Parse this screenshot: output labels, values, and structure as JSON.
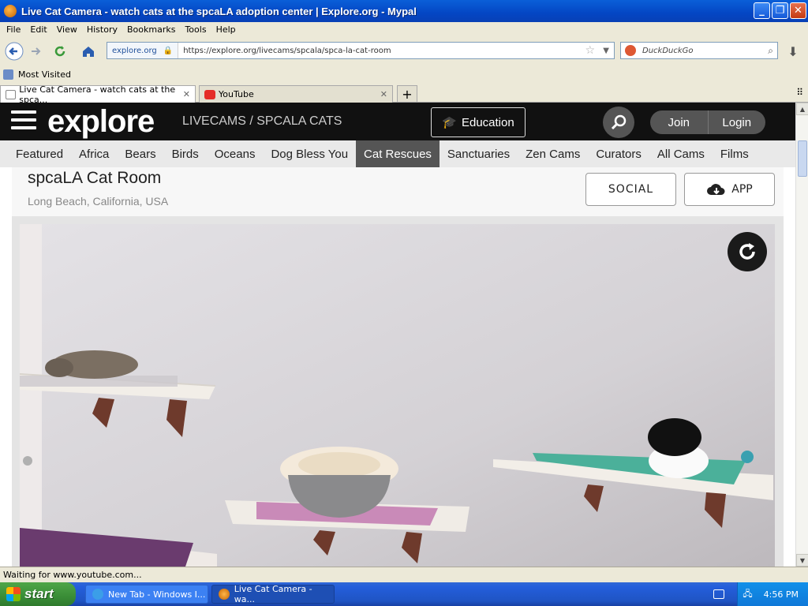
{
  "window": {
    "title": "Live Cat Camera - watch cats at the spcaLA adoption center | Explore.org - Mypal",
    "buttons": {
      "minimize": "_",
      "maximize": "❐",
      "close": "✕"
    }
  },
  "menu": [
    "File",
    "Edit",
    "View",
    "History",
    "Bookmarks",
    "Tools",
    "Help"
  ],
  "toolbar": {
    "site_badge": "explore.org",
    "url": "https://explore.org/livecams/spcala/spca-la-cat-room",
    "search_placeholder": "DuckDuckGo"
  },
  "bookmarks": {
    "most_visited": "Most Visited"
  },
  "tabs": [
    {
      "label": "Live Cat Camera - watch cats at the spca...",
      "active": true
    },
    {
      "label": "YouTube",
      "active": false
    }
  ],
  "site": {
    "logo": "explore",
    "breadcrumb": "LIVECAMS / SPCALA CATS",
    "education": "Education",
    "join": "Join",
    "login": "Login",
    "nav": [
      "Featured",
      "Africa",
      "Bears",
      "Birds",
      "Oceans",
      "Dog Bless You",
      "Cat Rescues",
      "Sanctuaries",
      "Zen Cams",
      "Curators",
      "All Cams",
      "Films"
    ],
    "nav_active": "Cat Rescues"
  },
  "cam": {
    "title": "spcaLA Cat Room",
    "location": "Long Beach, California, USA",
    "social": "SOCIAL",
    "app": "APP"
  },
  "status": "Waiting for www.youtube.com...",
  "taskbar": {
    "start": "start",
    "items": [
      "New Tab - Windows I...",
      "Live Cat Camera - wa..."
    ],
    "clock": "4:56 PM"
  },
  "colors": {
    "header_bg": "#111111",
    "nav_active_bg": "#555555",
    "xp_blue": "#245edb"
  }
}
